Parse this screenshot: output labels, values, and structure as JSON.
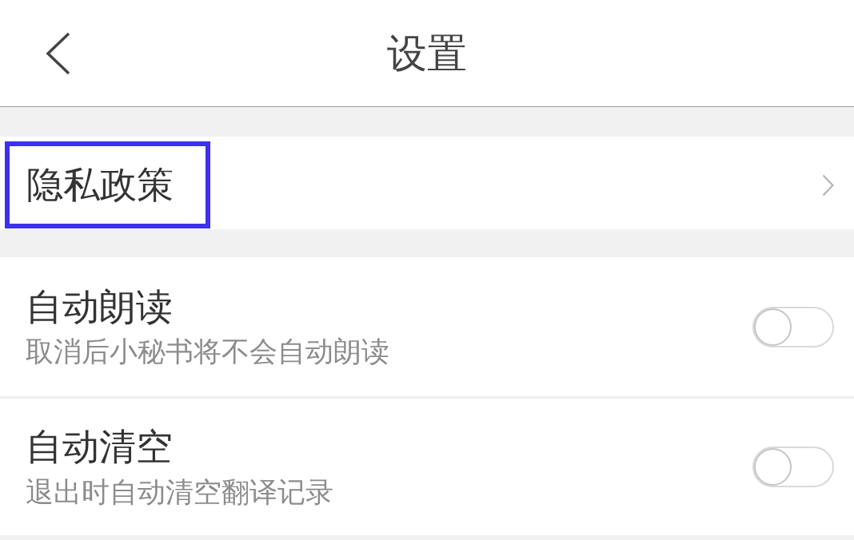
{
  "header": {
    "title": "设置"
  },
  "sections": [
    {
      "items": [
        {
          "kind": "link",
          "title": "隐私政策",
          "highlighted": true
        }
      ]
    },
    {
      "items": [
        {
          "kind": "toggle",
          "title": "自动朗读",
          "subtitle": "取消后小秘书将不会自动朗读",
          "on": false
        },
        {
          "kind": "toggle",
          "title": "自动清空",
          "subtitle": "退出时自动清空翻译记录",
          "on": false
        }
      ]
    }
  ]
}
